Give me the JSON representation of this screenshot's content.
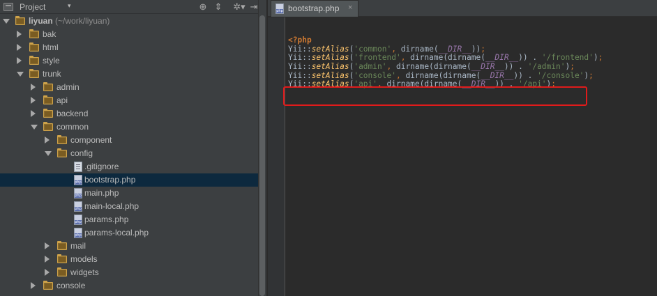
{
  "panel": {
    "title": "Project",
    "caret": "▾",
    "icons": [
      "target-icon",
      "collapse-all-icon",
      "settings-icon",
      "hide-icon"
    ]
  },
  "tree": [
    {
      "depth": 0,
      "type": "folder",
      "expanded": true,
      "label": "liyuan",
      "suffix": " (~/work/liyuan)",
      "root": true
    },
    {
      "depth": 1,
      "type": "folder",
      "expanded": false,
      "label": "bak"
    },
    {
      "depth": 1,
      "type": "folder",
      "expanded": false,
      "label": "html"
    },
    {
      "depth": 1,
      "type": "folder",
      "expanded": false,
      "label": "style"
    },
    {
      "depth": 1,
      "type": "folder",
      "expanded": true,
      "label": "trunk"
    },
    {
      "depth": 2,
      "type": "folder",
      "expanded": false,
      "label": "admin"
    },
    {
      "depth": 2,
      "type": "folder",
      "expanded": false,
      "label": "api"
    },
    {
      "depth": 2,
      "type": "folder",
      "expanded": false,
      "label": "backend"
    },
    {
      "depth": 2,
      "type": "folder",
      "expanded": true,
      "label": "common"
    },
    {
      "depth": 3,
      "type": "folder",
      "expanded": false,
      "label": "component"
    },
    {
      "depth": 3,
      "type": "folder",
      "expanded": true,
      "label": "config"
    },
    {
      "depth": 4,
      "type": "text",
      "label": ".gitignore"
    },
    {
      "depth": 4,
      "type": "php",
      "label": "bootstrap.php",
      "selected": true
    },
    {
      "depth": 4,
      "type": "php",
      "label": "main.php"
    },
    {
      "depth": 4,
      "type": "php",
      "label": "main-local.php"
    },
    {
      "depth": 4,
      "type": "php",
      "label": "params.php"
    },
    {
      "depth": 4,
      "type": "php",
      "label": "params-local.php"
    },
    {
      "depth": 3,
      "type": "folder",
      "expanded": false,
      "label": "mail"
    },
    {
      "depth": 3,
      "type": "folder",
      "expanded": false,
      "label": "models"
    },
    {
      "depth": 3,
      "type": "folder",
      "expanded": false,
      "label": "widgets"
    },
    {
      "depth": 2,
      "type": "folder",
      "expanded": false,
      "label": "console"
    }
  ],
  "editor": {
    "tab_label": "bootstrap.php",
    "tab_close": "×",
    "lines": [
      [
        {
          "c": "kw",
          "t": "<?php"
        }
      ],
      [
        {
          "c": "plain",
          "t": "Yii::"
        },
        {
          "c": "fn",
          "t": "setAlias"
        },
        {
          "c": "plain",
          "t": "("
        },
        {
          "c": "str",
          "t": "'common'"
        },
        {
          "c": "punct",
          "t": ", "
        },
        {
          "c": "plain",
          "t": "dirname("
        },
        {
          "c": "const",
          "t": "__DIR__"
        },
        {
          "c": "plain",
          "t": "))"
        },
        {
          "c": "punct",
          "t": ";"
        }
      ],
      [
        {
          "c": "plain",
          "t": "Yii::"
        },
        {
          "c": "fn",
          "t": "setAlias"
        },
        {
          "c": "plain",
          "t": "("
        },
        {
          "c": "str",
          "t": "'frontend'"
        },
        {
          "c": "punct",
          "t": ", "
        },
        {
          "c": "plain",
          "t": "dirname(dirname("
        },
        {
          "c": "const",
          "t": "__DIR__"
        },
        {
          "c": "plain",
          "t": ")) . "
        },
        {
          "c": "str",
          "t": "'/frontend'"
        },
        {
          "c": "plain",
          "t": ")"
        },
        {
          "c": "punct",
          "t": ";"
        }
      ],
      [
        {
          "c": "plain",
          "t": "Yii::"
        },
        {
          "c": "fn",
          "t": "setAlias"
        },
        {
          "c": "plain",
          "t": "("
        },
        {
          "c": "str",
          "t": "'admin'"
        },
        {
          "c": "punct",
          "t": ", "
        },
        {
          "c": "plain",
          "t": "dirname(dirname("
        },
        {
          "c": "const",
          "t": "__DIR__"
        },
        {
          "c": "plain",
          "t": ")) . "
        },
        {
          "c": "str",
          "t": "'/admin'"
        },
        {
          "c": "plain",
          "t": ")"
        },
        {
          "c": "punct",
          "t": ";"
        }
      ],
      [
        {
          "c": "plain",
          "t": "Yii::"
        },
        {
          "c": "fn",
          "t": "setAlias"
        },
        {
          "c": "plain",
          "t": "("
        },
        {
          "c": "str",
          "t": "'console'"
        },
        {
          "c": "punct",
          "t": ", "
        },
        {
          "c": "plain",
          "t": "dirname(dirname("
        },
        {
          "c": "const",
          "t": "__DIR__"
        },
        {
          "c": "plain",
          "t": ")) . "
        },
        {
          "c": "str",
          "t": "'/console'"
        },
        {
          "c": "plain",
          "t": ")"
        },
        {
          "c": "punct",
          "t": ";"
        }
      ],
      [
        {
          "c": "plain",
          "t": "Yii::"
        },
        {
          "c": "fn",
          "t": "setAlias"
        },
        {
          "c": "plain",
          "t": "("
        },
        {
          "c": "str",
          "t": "'api'"
        },
        {
          "c": "punct",
          "t": ", "
        },
        {
          "c": "plain",
          "t": "dirname(dirname("
        },
        {
          "c": "const",
          "t": "__DIR__"
        },
        {
          "c": "plain",
          "t": ")) . "
        },
        {
          "c": "str",
          "t": "'/api'"
        },
        {
          "c": "plain",
          "t": ")"
        },
        {
          "c": "punct",
          "t": ";"
        }
      ]
    ]
  },
  "colors": {
    "highlight_box": "#e01b1b",
    "selected_row": "#0d293e",
    "keyword": "#cc7832",
    "function": "#ffc66d",
    "string": "#6a8759",
    "constant": "#9876aa"
  }
}
